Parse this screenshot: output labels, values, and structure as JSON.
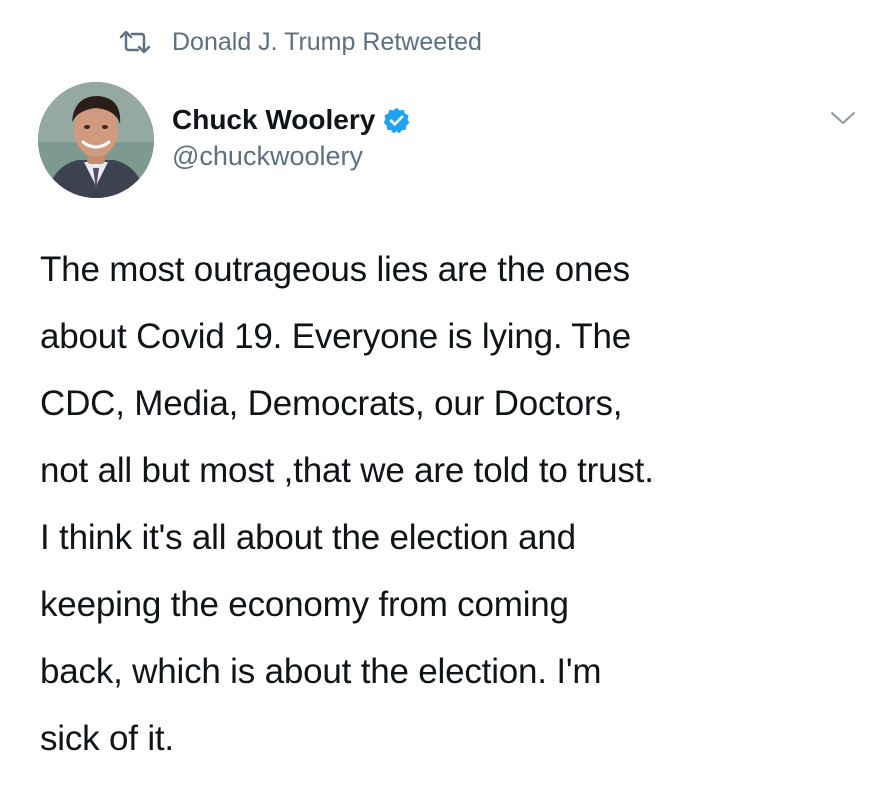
{
  "retweet": {
    "label": "Donald J. Trump Retweeted",
    "icon": "retweet-icon"
  },
  "author": {
    "display_name": "Chuck Woolery",
    "handle": "@chuckwoolery",
    "verified": true,
    "verified_color": "#1da1f2"
  },
  "tweet": {
    "lines": [
      "The most outrageous lies are the ones",
      "about Covid 19. Everyone is lying. The",
      "CDC, Media, Democrats, our Doctors,",
      "not all but most ,that we are told to trust.",
      "I think it's all about the election and",
      "keeping the economy from coming",
      "back, which is about the election. I'm",
      "sick of it."
    ]
  },
  "colors": {
    "text_primary": "#0f1419",
    "text_secondary": "#5b7083",
    "verified": "#1da1f2"
  }
}
